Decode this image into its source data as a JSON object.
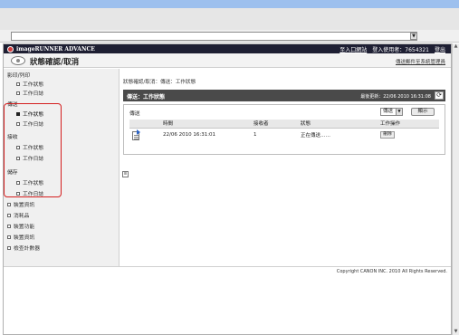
{
  "browser": {
    "address_value": ""
  },
  "header": {
    "brand": "imageRUNNER ADVANCE",
    "links": [
      "至入口網站",
      "登入使用者：7654321",
      "登出"
    ]
  },
  "titlebar": {
    "title": "狀態確認/取消",
    "manager_link": "傳送郵件至系統管理員"
  },
  "sidebar": {
    "copy_print": {
      "label": "影印/列印",
      "items": [
        "工作狀態",
        "工作日誌"
      ]
    },
    "send": {
      "label": "傳送",
      "items": [
        "工作狀態",
        "工作日誌"
      ],
      "active_index": 0
    },
    "receive": {
      "label": "接收",
      "items": [
        "工作狀態",
        "工作日誌"
      ]
    },
    "store": {
      "label": "儲存",
      "items": [
        "工作狀態",
        "工作日誌"
      ]
    },
    "other": [
      "裝置資訊",
      "消耗品",
      "裝置功能",
      "裝置資訊",
      "檢查計數器"
    ]
  },
  "content": {
    "breadcrumb": "狀態確認/取消：傳送：工作狀態",
    "panel_title": "傳送：工作狀態",
    "last_update": "最後更新：22/06 2010 16:31:08",
    "filter_label": "傳送",
    "filter_selected": "傳送",
    "show_button": "顯示",
    "table": {
      "headers": [
        "",
        "時間",
        "接收者",
        "狀態",
        "工作操作"
      ],
      "rows": [
        {
          "time": "22/06 2010 16:31:01",
          "recipient": "1",
          "status": "正在傳送……",
          "action": "刪除"
        }
      ]
    }
  },
  "footer": {
    "copyright": "Copyright CANON INC. 2010 All Rights Reserved."
  }
}
